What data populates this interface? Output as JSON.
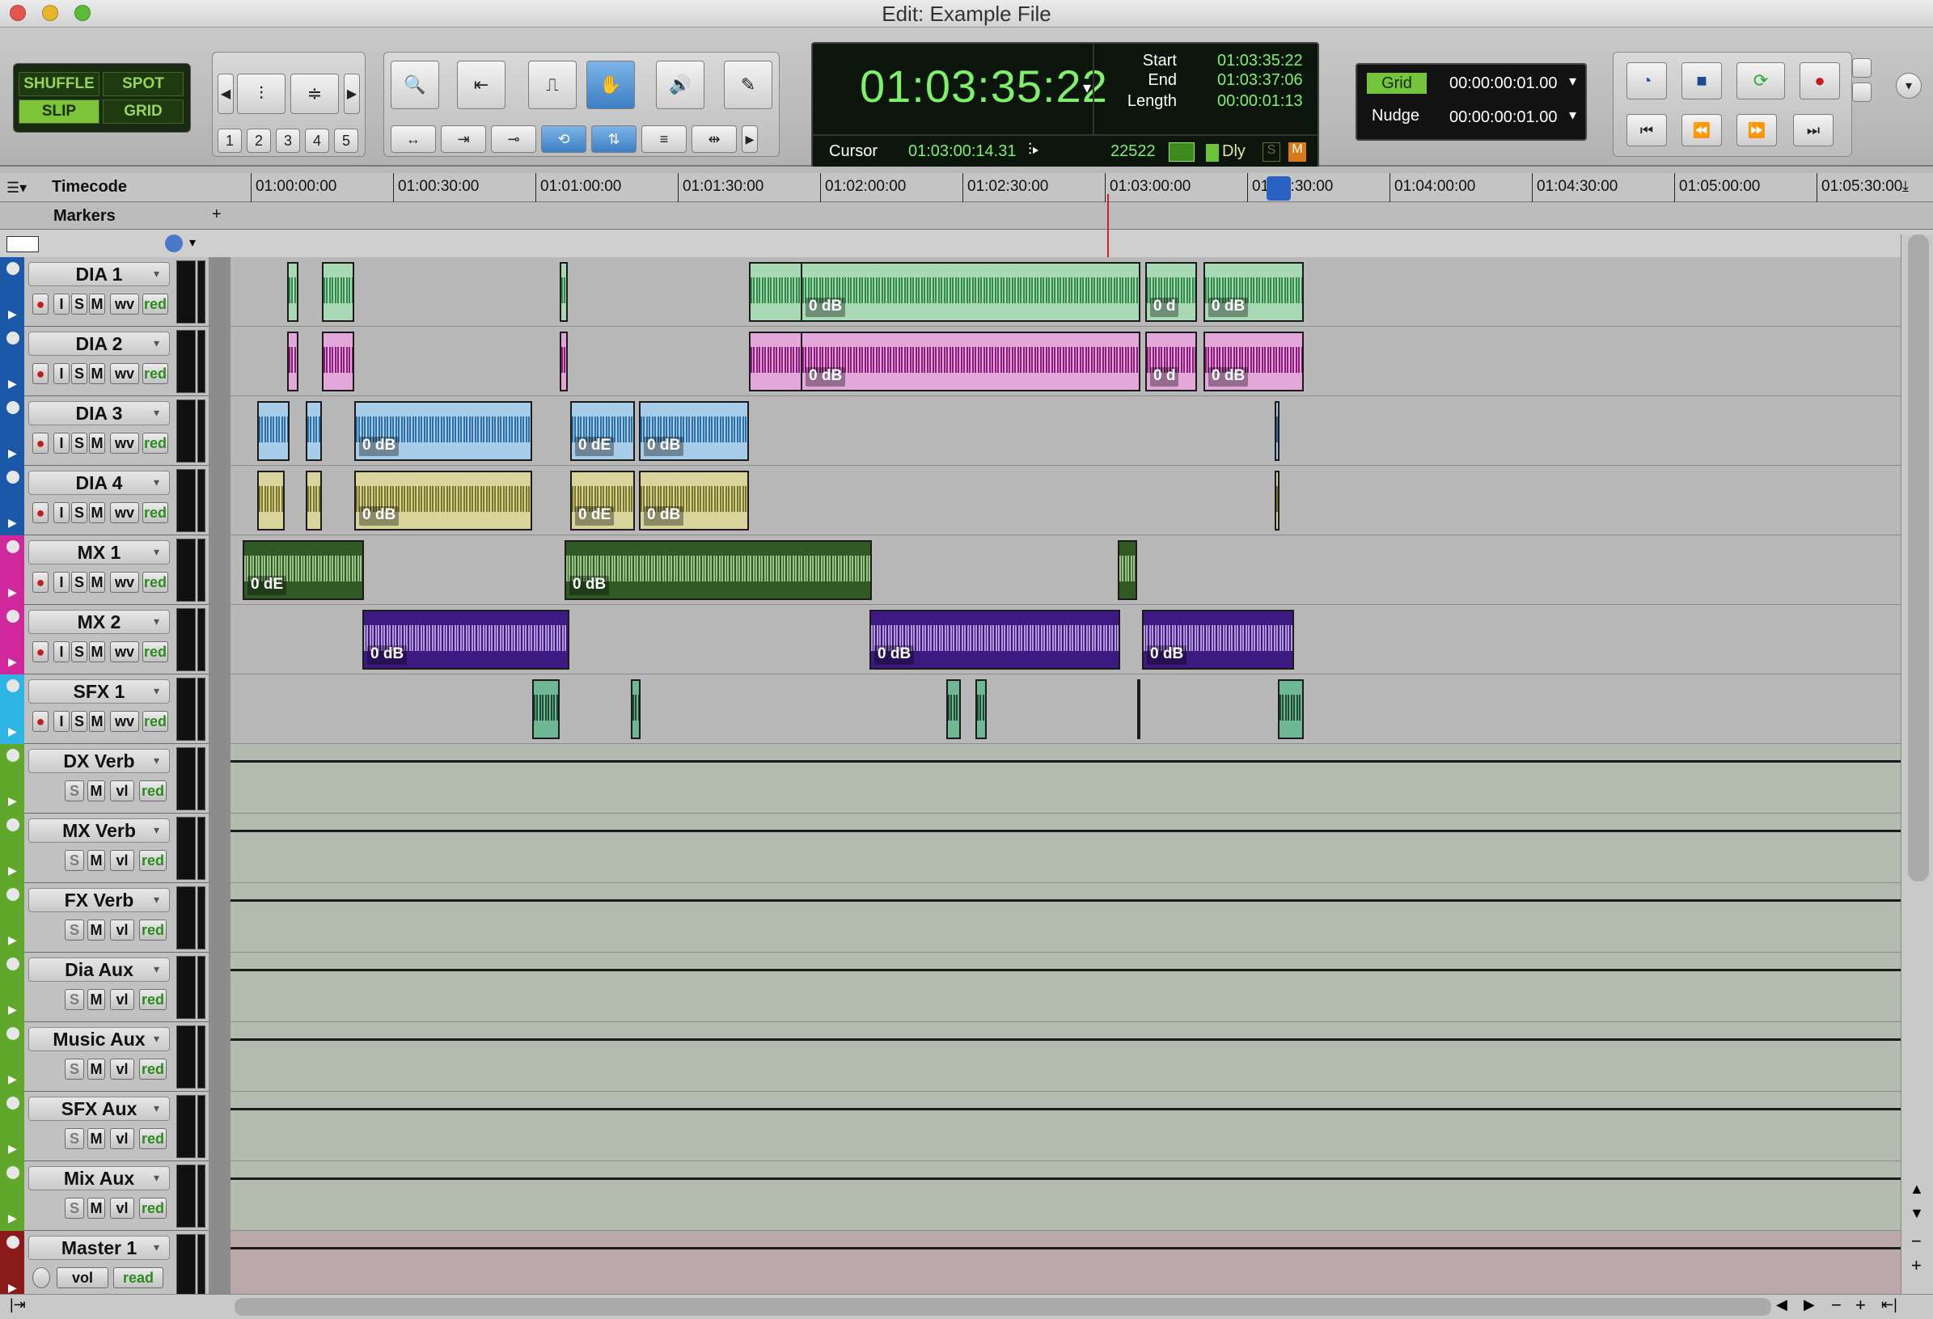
{
  "window": {
    "title": "Edit: Example File"
  },
  "toolbar": {
    "modes": {
      "shuffle": "SHUFFLE",
      "spot": "SPOT",
      "slip": "SLIP",
      "grid": "GRID"
    },
    "zoom_presets": [
      "1",
      "2",
      "3",
      "4",
      "5"
    ],
    "counter": {
      "main": "01:03:35:22",
      "start_label": "Start",
      "start": "01:03:35:22",
      "end_label": "End",
      "end": "01:03:37:06",
      "length_label": "Length",
      "length": "00:00:01:13",
      "cursor_label": "Cursor",
      "cursor": "01:03:00:14.31",
      "sample_value": "22522",
      "dly_label": "Dly",
      "s_label": "S",
      "m_label": "M"
    },
    "grid": {
      "label": "Grid",
      "value": "00:00:00:01.00"
    },
    "nudge": {
      "label": "Nudge",
      "value": "00:00:00:01.00"
    }
  },
  "rulers": {
    "timecode_label": "Timecode",
    "markers_label": "Markers",
    "ticks": [
      "01:00:00:00",
      "01:00:30:00",
      "01:01:00:00",
      "01:01:30:00",
      "01:02:00:00",
      "01:02:30:00",
      "01:03:00:00",
      "01:03:30:00",
      "01:04:00:00",
      "01:04:30:00",
      "01:05:00:00",
      "01:05:30:00"
    ]
  },
  "track_buttons": {
    "rec": "●",
    "input": "I",
    "solo": "S",
    "mute": "M",
    "view_wv": "wv",
    "view_vl": "vl",
    "view_vol": "vol",
    "auto_read": "read",
    "auto_red": "red"
  },
  "tracks": [
    {
      "name": "DIA 1",
      "type": "audio",
      "color": "#1c58a8"
    },
    {
      "name": "DIA 2",
      "type": "audio",
      "color": "#1c58a8"
    },
    {
      "name": "DIA 3",
      "type": "audio",
      "color": "#1c58a8"
    },
    {
      "name": "DIA 4",
      "type": "audio",
      "color": "#1c58a8"
    },
    {
      "name": "MX 1",
      "type": "audio",
      "color": "#d0289c"
    },
    {
      "name": "MX 2",
      "type": "audio",
      "color": "#d0289c"
    },
    {
      "name": "SFX 1",
      "type": "audio",
      "color": "#2fb4e6"
    },
    {
      "name": "DX Verb",
      "type": "aux",
      "color": "#5fa82c"
    },
    {
      "name": "MX Verb",
      "type": "aux",
      "color": "#5fa82c"
    },
    {
      "name": "FX Verb",
      "type": "aux",
      "color": "#5fa82c"
    },
    {
      "name": "Dia Aux",
      "type": "aux",
      "color": "#5fa82c"
    },
    {
      "name": "Music Aux",
      "type": "aux",
      "color": "#5fa82c"
    },
    {
      "name": "SFX Aux",
      "type": "aux",
      "color": "#5fa82c"
    },
    {
      "name": "Mix Aux",
      "type": "aux",
      "color": "#5fa82c"
    },
    {
      "name": "Master 1",
      "type": "master",
      "color": "#8a1a1a"
    }
  ],
  "clip_label": "0 dB",
  "clip_label_short": "0 d",
  "clip_label_cut": "0 dE"
}
